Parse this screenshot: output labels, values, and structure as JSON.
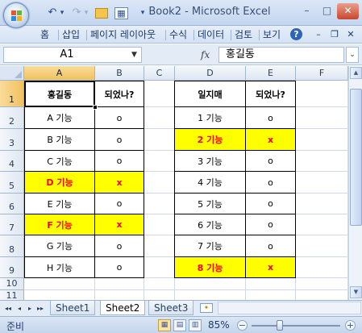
{
  "window": {
    "title": "Book2 - Microsoft Excel",
    "minimize": "–",
    "maximize": "□",
    "close": "✕"
  },
  "quick_access": {
    "undo": "↶",
    "undo_dropdown": "▾",
    "redo": "↷",
    "redo_dropdown": "▾",
    "folder": "▭",
    "form": "▦",
    "customize": "▾"
  },
  "ribbon": {
    "tabs": [
      "홈",
      "삽입",
      "페이지 레이아웃",
      "수식",
      "데이터",
      "검토",
      "보기"
    ],
    "help": "?",
    "minimize": "–",
    "restore": "❐",
    "close": "✕"
  },
  "formula_bar": {
    "name_box": "A1",
    "name_box_arrow": "▼",
    "fx": "fx",
    "content": "홍길동",
    "expand": "⌄"
  },
  "sheet": {
    "column_headers": [
      "A",
      "B",
      "C",
      "D",
      "E",
      "F"
    ],
    "row_headers": [
      "1",
      "2",
      "3",
      "4",
      "5",
      "6",
      "7",
      "8",
      "9",
      "10",
      "11"
    ],
    "left_table": {
      "header": [
        "홍길동",
        "되었나?"
      ],
      "rows": [
        {
          "name": "A 기능",
          "done": "o",
          "highlight": false
        },
        {
          "name": "B 기능",
          "done": "o",
          "highlight": false
        },
        {
          "name": "C 기능",
          "done": "o",
          "highlight": false
        },
        {
          "name": "D 기능",
          "done": "x",
          "highlight": true
        },
        {
          "name": "E 기능",
          "done": "o",
          "highlight": false
        },
        {
          "name": "F 기능",
          "done": "x",
          "highlight": true
        },
        {
          "name": "G 기능",
          "done": "o",
          "highlight": false
        },
        {
          "name": "H 기능",
          "done": "o",
          "highlight": false
        }
      ]
    },
    "right_table": {
      "header": [
        "일지매",
        "되었나?"
      ],
      "rows": [
        {
          "name": "1 기능",
          "done": "o",
          "highlight": false
        },
        {
          "name": "2 기능",
          "done": "x",
          "highlight": true
        },
        {
          "name": "3 기능",
          "done": "o",
          "highlight": false
        },
        {
          "name": "4 기능",
          "done": "o",
          "highlight": false
        },
        {
          "name": "5 기능",
          "done": "o",
          "highlight": false
        },
        {
          "name": "6 기능",
          "done": "o",
          "highlight": false
        },
        {
          "name": "7 기능",
          "done": "o",
          "highlight": false
        },
        {
          "name": "8 기능",
          "done": "x",
          "highlight": true
        }
      ]
    },
    "highlight_fill": "#ffff00",
    "highlight_text": "#ff0000"
  },
  "sheet_tabs": {
    "nav": [
      "◂◂",
      "◂",
      "▸",
      "▸▸"
    ],
    "tabs": [
      "Sheet1",
      "Sheet2",
      "Sheet3"
    ],
    "active": "Sheet2",
    "new_sheet": "✦"
  },
  "status": {
    "mode": "준비",
    "zoom": "85%",
    "zoom_minus": "−",
    "zoom_plus": "+",
    "views": [
      "▦",
      "▤",
      "▥"
    ]
  },
  "vscroll": {
    "up": "▲",
    "down": "▼"
  }
}
